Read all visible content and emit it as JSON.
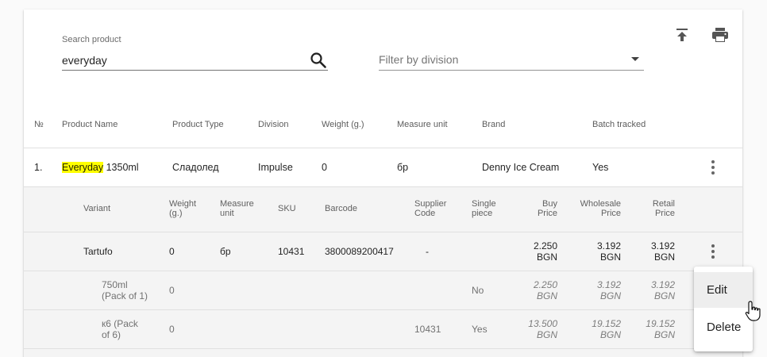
{
  "search": {
    "label": "Search product",
    "value": "everyday"
  },
  "filter": {
    "placeholder": "Filter by division"
  },
  "toolbar": {
    "upload_icon": "upload-icon",
    "print_icon": "print-icon"
  },
  "table": {
    "columns": [
      "№",
      "Product Name",
      "Product Type",
      "Division",
      "Weight (g.)",
      "Measure unit",
      "Brand",
      "Batch tracked"
    ],
    "rows": [
      {
        "num": "1.",
        "name_highlight": "Everyday",
        "name_rest": " 1350ml",
        "type": "Сладолед",
        "division": "Impulse",
        "weight": "0",
        "unit": "бр",
        "brand": "Denny Ice Cream",
        "batch": "Yes"
      }
    ]
  },
  "variants": {
    "columns": {
      "variant": "Variant",
      "weight_1": "Weight",
      "weight_2": "(g.)",
      "measure_1": "Measure",
      "measure_2": "unit",
      "sku": "SKU",
      "barcode": "Barcode",
      "supplier_1": "Supplier",
      "supplier_2": "Code",
      "single_1": "Single",
      "single_2": "piece",
      "buy_1": "Buy",
      "buy_2": "Price",
      "wholesale_1": "Wholesale",
      "wholesale_2": "Price",
      "retail_1": "Retail",
      "retail_2": "Price"
    },
    "row": {
      "name": "Tartufo",
      "weight": "0",
      "unit": "бр",
      "sku": "10431",
      "barcode": "3800089200417",
      "supplier": "-",
      "buy_1": "2.250",
      "buy_2": "BGN",
      "wholesale_1": "3.192",
      "wholesale_2": "BGN",
      "retail_1": "3.192",
      "retail_2": "BGN"
    },
    "packs": [
      {
        "name_1": "750ml",
        "name_2": "(Pack of 1)",
        "weight": "0",
        "supplier": "",
        "single": "No",
        "buy_1": "2.250",
        "buy_2": "BGN",
        "wholesale_1": "3.192",
        "wholesale_2": "BGN",
        "retail_1": "3.192",
        "retail_2": "BGN"
      },
      {
        "name_1": "к6 (Pack",
        "name_2": "of 6)",
        "weight": "0",
        "supplier": "10431",
        "single": "Yes",
        "buy_1": "13.500",
        "buy_2": "BGN",
        "wholesale_1": "19.152",
        "wholesale_2": "BGN",
        "retail_1": "19.152",
        "retail_2": "BGN"
      }
    ]
  },
  "context_menu": {
    "items": [
      "Edit",
      "Delete"
    ]
  },
  "colors": {
    "highlight": "#ffff00",
    "band": "#f4f4f4"
  }
}
